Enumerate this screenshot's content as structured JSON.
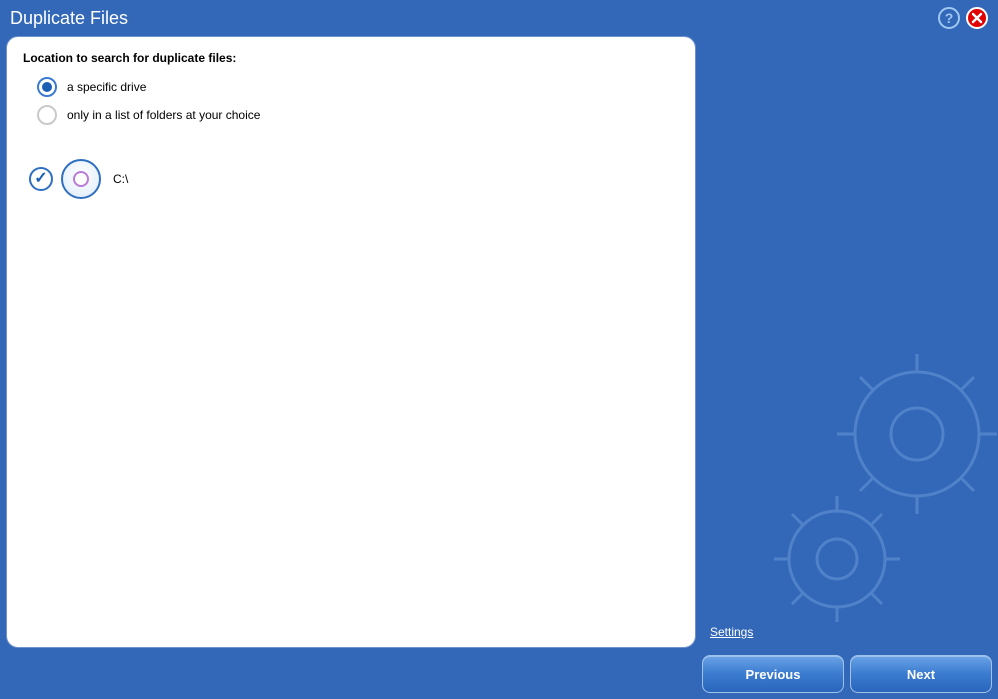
{
  "header": {
    "title": "Duplicate Files"
  },
  "main": {
    "heading": "Location to search for duplicate files:",
    "options": {
      "specific_drive": "a specific drive",
      "folder_list": "only in a list of folders at your choice"
    },
    "drive": {
      "label": "C:\\"
    }
  },
  "side": {
    "settings": "Settings"
  },
  "footer": {
    "previous": "Previous",
    "next": "Next"
  }
}
